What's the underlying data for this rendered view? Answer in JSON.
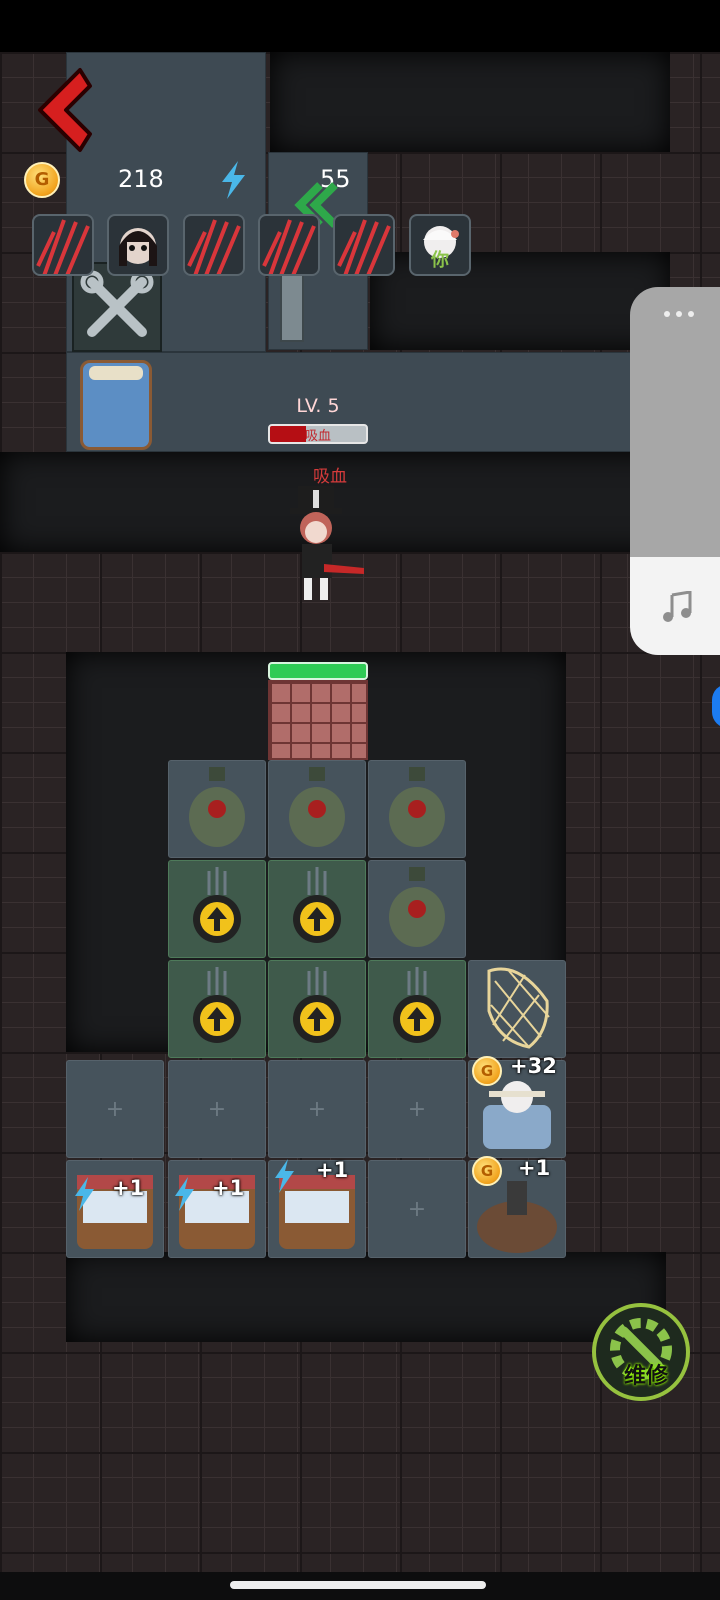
{
  "hud": {
    "gold": "218",
    "energy": "55",
    "back_icon": "chevron-left",
    "gold_icon": "G",
    "energy_icon": "lightning-bolt",
    "avatars": [
      "claw-marks-portrait",
      "girl-ghost-portrait",
      "claw-marks-portrait",
      "claw-marks-portrait",
      "claw-marks-portrait",
      "white-hair-girl-portrait"
    ],
    "avatar_label": "你"
  },
  "enemy": {
    "level": "LV. 5",
    "hp_fraction": 0.38,
    "hp_bar_text": "吸血",
    "skill": "吸血"
  },
  "door": {
    "hp_fraction": 1.0
  },
  "base": {
    "generator_gains": [
      "+1",
      "+1",
      "+1"
    ],
    "bed_gain": "+32",
    "gold_pile_gain": "+1",
    "generator_gain_icon": "lightning-bolt",
    "coin_label": "G"
  },
  "repair_button": {
    "label": "维修",
    "icon": "gear-wrench"
  },
  "side_panel": {
    "menu_icon": "more-dots",
    "music_icon": "music-note"
  },
  "colors": {
    "accent_red": "#c31a1a",
    "energy_blue": "#4ab7e8",
    "repair_green": "#8bc34a"
  }
}
